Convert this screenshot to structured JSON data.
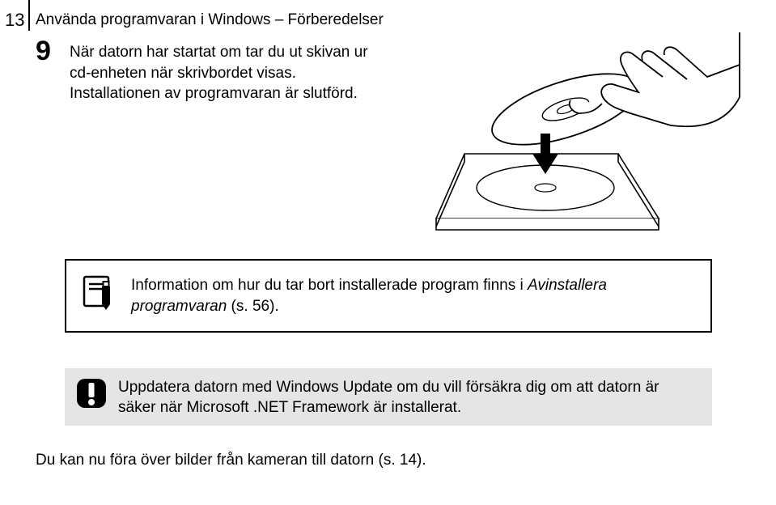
{
  "page_number": "13",
  "section_title": "Använda programvaran i Windows – Förberedelser",
  "step": {
    "number": "9",
    "line1": "När datorn har startat om tar du ut skivan ur cd-enheten när skrivbordet visas.",
    "line2": "Installationen av programvaran är slutförd."
  },
  "info_box": {
    "text_before_italic": "Information om hur du tar bort installerade program finns i ",
    "italic": "Avinstallera programvaran",
    "text_after_italic": " (s. 56)."
  },
  "warn_box": {
    "text": "Uppdatera datorn med Windows Update om du vill försäkra dig om att datorn är säker när Microsoft .NET Framework är installerat."
  },
  "footer": "Du kan nu föra över bilder från kameran till datorn (s. 14)."
}
